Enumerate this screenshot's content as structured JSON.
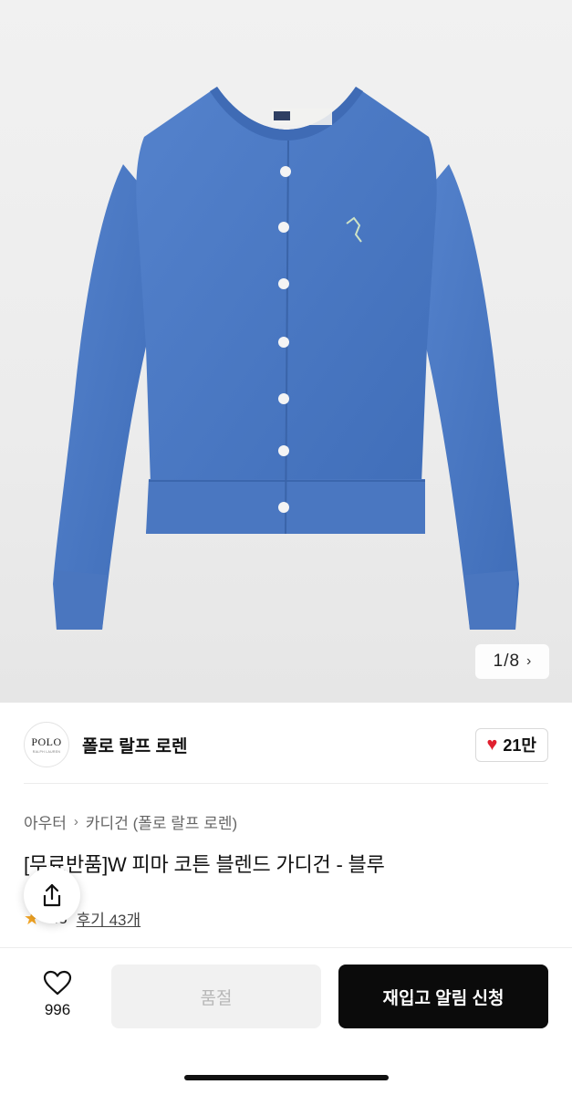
{
  "image": {
    "alt": "Blue cardigan product photo",
    "pager": {
      "current": "1",
      "separator": "/",
      "total": "8"
    }
  },
  "brand": {
    "logo_text": "POLO",
    "logo_subtext": "RALPH LAUREN",
    "name": "폴로 랄프 로렌",
    "likes": "21만"
  },
  "breadcrumb": {
    "category": "아우터",
    "subcategory": "카디건 (폴로 랄프 로렌)"
  },
  "product": {
    "title": "[무료반품]W 피마 코튼 블렌드 가디건 - 블루",
    "rating": "4.8",
    "reviews": "후기 43개"
  },
  "bottom_bar": {
    "wish_count": "996",
    "soldout_label": "품절",
    "restock_label": "재입고 알림 신청"
  },
  "colors": {
    "cardigan": "#4a78c2",
    "heart": "#e0202f",
    "star": "#f5a623",
    "primary_button": "#0b0b0b"
  },
  "icons": [
    "chevron-right-icon",
    "heart-icon",
    "share-icon",
    "star-icon",
    "heart-outline-icon"
  ]
}
